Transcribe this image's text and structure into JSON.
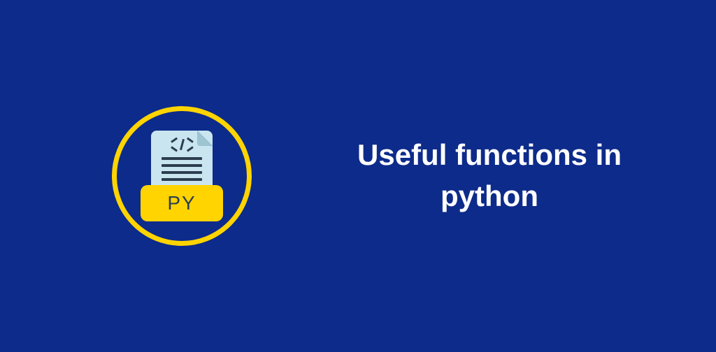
{
  "title": "Useful functions in python",
  "file_label": "PY",
  "colors": {
    "background": "#0d2b8a",
    "accent": "#ffd400",
    "file_body": "#c9e5ef",
    "text_dark": "#2c3e50",
    "text_light": "#ffffff"
  }
}
